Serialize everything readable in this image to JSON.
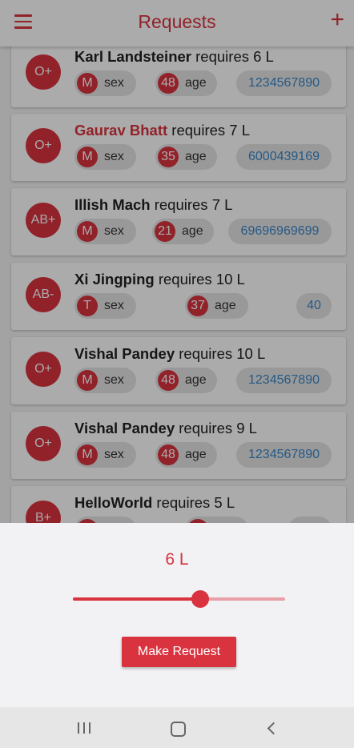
{
  "appbar": {
    "title": "Requests",
    "add_symbol": "+"
  },
  "requests": [
    {
      "blood": "O+",
      "name": "Karl Landsteiner",
      "suffix": " requires 6 L",
      "gender": "M",
      "sex_label": "sex",
      "age": "48",
      "age_label": "age",
      "phone": "1234567890"
    },
    {
      "blood": "O+",
      "name": "Gaurav Bhatt",
      "suffix": " requires 7 L",
      "gender": "M",
      "sex_label": "sex",
      "age": "35",
      "age_label": "age",
      "phone": "6000439169"
    },
    {
      "blood": "AB+",
      "name": "Illish Mach",
      "suffix": " requires 7 L",
      "gender": "M",
      "sex_label": "sex",
      "age": "21",
      "age_label": "age",
      "phone": "69696969699"
    },
    {
      "blood": "AB-",
      "name": "Xi Jingping",
      "suffix": " requires 10 L",
      "gender": "T",
      "sex_label": "sex",
      "age": "37",
      "age_label": "age",
      "phone": "40"
    },
    {
      "blood": "O+",
      "name": "Vishal Pandey",
      "suffix": " requires 10 L",
      "gender": "M",
      "sex_label": "sex",
      "age": "48",
      "age_label": "age",
      "phone": "1234567890"
    },
    {
      "blood": "O+",
      "name": "Vishal Pandey",
      "suffix": " requires 9 L",
      "gender": "M",
      "sex_label": "sex",
      "age": "48",
      "age_label": "age",
      "phone": "1234567890"
    },
    {
      "blood": "B+",
      "name": "HelloWorld",
      "suffix": " requires 5 L",
      "gender": "",
      "sex_label": "",
      "age": "",
      "age_label": "",
      "phone": ""
    }
  ],
  "sheet": {
    "amount": "6 L",
    "slider_fraction": 0.6,
    "button_label": "Make Request"
  },
  "colors": {
    "accent": "#d9333f",
    "phone": "#3a86c8"
  },
  "icons": {
    "menu": "hamburger-icon",
    "add": "plus-icon",
    "recents": "recents-icon",
    "home": "home-icon",
    "back": "back-icon"
  }
}
